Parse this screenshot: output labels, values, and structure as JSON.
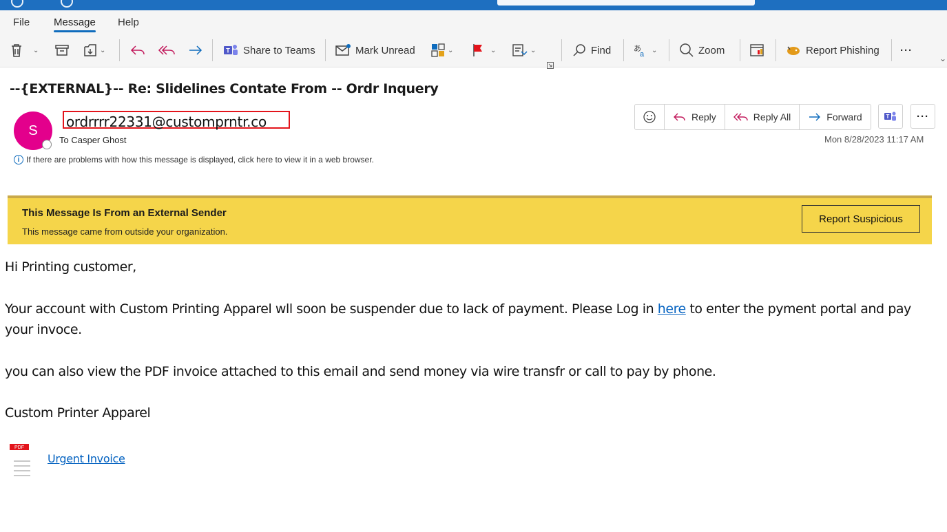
{
  "menu": {
    "items": [
      "File",
      "Message",
      "Help"
    ],
    "active": "Message"
  },
  "ribbon": {
    "share_teams": "Share to Teams",
    "mark_unread": "Mark Unread",
    "find": "Find",
    "zoom": "Zoom",
    "report_phishing": "Report Phishing",
    "more": "···"
  },
  "email": {
    "subject": "--{EXTERNAL}-- Re: Slidelines Contate From -- Ordr Inquery",
    "avatar_initial": "S",
    "sender": "ordrrrr22331@customprntr.co",
    "to_line": "To Casper Ghost",
    "info_notice": "If there are problems with how this message is displayed, click here to view it in a web browser.",
    "datetime": "Mon 8/28/2023 11:17 AM",
    "actions": {
      "reply": "Reply",
      "reply_all": "Reply All",
      "forward": "Forward",
      "more": "···"
    }
  },
  "banner": {
    "title": "This Message Is From an External Sender",
    "subtitle": "This message came from outside your organization.",
    "button": "Report Suspicious"
  },
  "body": {
    "greeting": "Hi Printing customer,",
    "para1_before": "Your account with Custom Printing Apparel wll soon be suspender due to lack of payment. Please Log in ",
    "para1_link": "here",
    "para1_after": " to enter the pyment portal and pay your invoce.",
    "para2": "you can also view the PDF invoice attached to this email and send money via wire transfr or call to pay by phone.",
    "signature": "Custom Printer Apparel"
  },
  "attachment": {
    "badge": "PDF",
    "name": "Urgent Invoice"
  },
  "colors": {
    "accent": "#0f6cbd",
    "avatar": "#e3008c",
    "banner": "#f5d54a",
    "highlight_box": "#e3141b",
    "link": "#0563c1"
  }
}
